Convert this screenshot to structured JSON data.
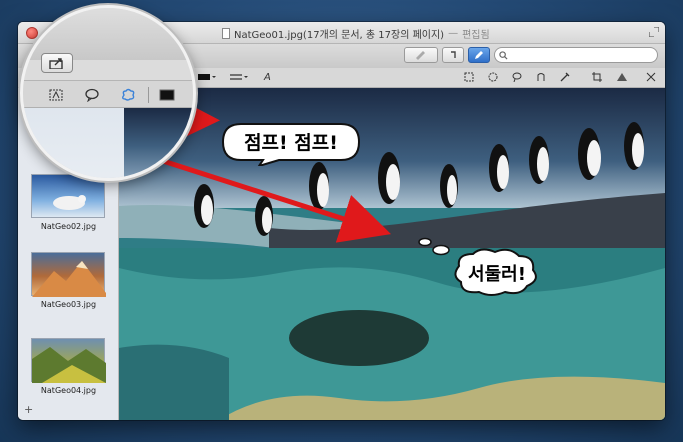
{
  "window": {
    "title": "NatGeo01.jpg(17개의 문서, 총 17장의 페이지)",
    "separator": "—",
    "edited_label": "편집됨"
  },
  "toolbar": {
    "search_placeholder": ""
  },
  "markup": {
    "text_tool_glyph": "A"
  },
  "sidebar": {
    "thumbnails": [
      {
        "label": "NatGeo02.jpg"
      },
      {
        "label": "NatGeo03.jpg"
      },
      {
        "label": "NatGeo04.jpg"
      }
    ],
    "add_button_glyph": "+"
  },
  "annotations": {
    "speech_bubble_text": "점프! 점프!",
    "thought_bubble_text": "서둘러!"
  },
  "colors": {
    "arrow": "#e0191b",
    "accent": "#3b82d8"
  }
}
